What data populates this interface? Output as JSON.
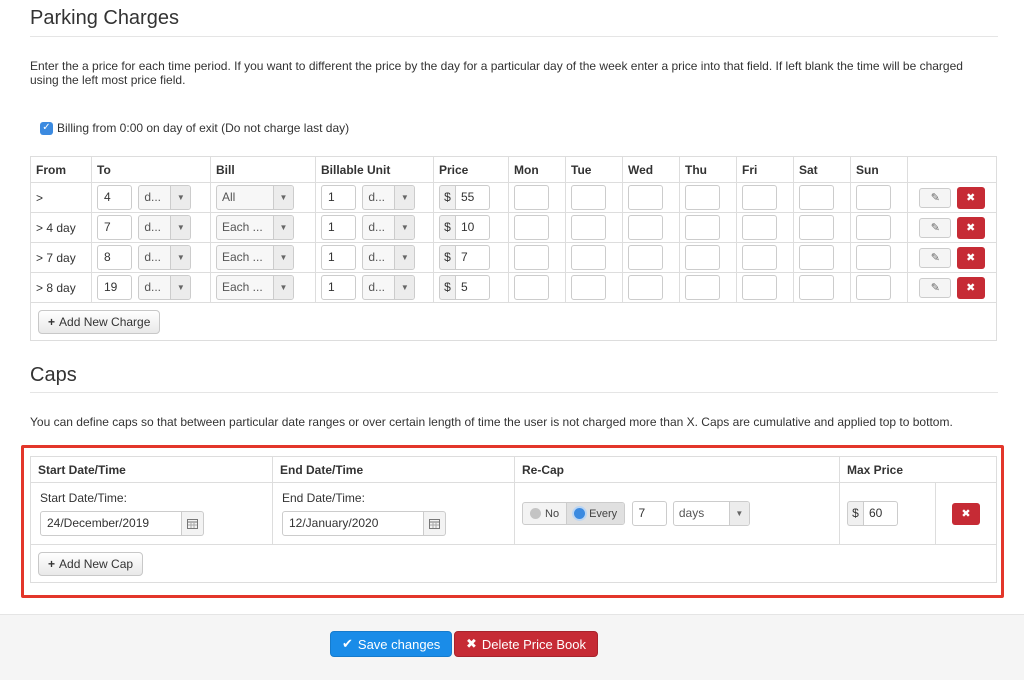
{
  "parking": {
    "title": "Parking Charges",
    "description": "Enter the a price for each time period. If you want to different the price by the day for a particular day of the week enter a price into that field. If left blank the time will be charged using the left most price field.",
    "billing_checkbox": {
      "checked": true,
      "label": "Billing from 0:00 on day of exit (Do not charge last day)"
    },
    "columns": [
      "From",
      "To",
      "Bill",
      "Billable Unit",
      "Price",
      "Mon",
      "Tue",
      "Wed",
      "Thu",
      "Fri",
      "Sat",
      "Sun"
    ],
    "currency": "$",
    "rows": [
      {
        "from": ">",
        "to": "4",
        "to_unit": "d...",
        "bill": "All",
        "unit_qty": "1",
        "unit": "d...",
        "price": "55"
      },
      {
        "from": "> 4 day",
        "to": "7",
        "to_unit": "d...",
        "bill": "Each ...",
        "unit_qty": "1",
        "unit": "d...",
        "price": "10"
      },
      {
        "from": "> 7 day",
        "to": "8",
        "to_unit": "d...",
        "bill": "Each ...",
        "unit_qty": "1",
        "unit": "d...",
        "price": "7"
      },
      {
        "from": "> 8 day",
        "to": "19",
        "to_unit": "d...",
        "bill": "Each ...",
        "unit_qty": "1",
        "unit": "d...",
        "price": "5"
      }
    ],
    "add_button": "Add New Charge"
  },
  "caps": {
    "title": "Caps",
    "description": "You can define caps so that between particular date ranges or over certain length of time the user is not charged more than X. Caps are cumulative and applied top to bottom.",
    "columns": [
      "Start Date/Time",
      "End Date/Time",
      "Re-Cap",
      "Max Price"
    ],
    "row": {
      "start_label": "Start Date/Time:",
      "start_value": "24/December/2019",
      "end_label": "End Date/Time:",
      "end_value": "12/January/2020",
      "recap_no": "No",
      "recap_every": "Every",
      "recap_selected": "Every",
      "recap_qty": "7",
      "recap_unit": "days",
      "currency": "$",
      "max_price": "60"
    },
    "add_button": "Add New Cap"
  },
  "footer": {
    "save_label": "Save changes",
    "delete_label": "Delete Price Book"
  },
  "colors": {
    "primary": "#1a8ce8",
    "danger": "#c62b35",
    "highlight_border": "#e3362a"
  }
}
